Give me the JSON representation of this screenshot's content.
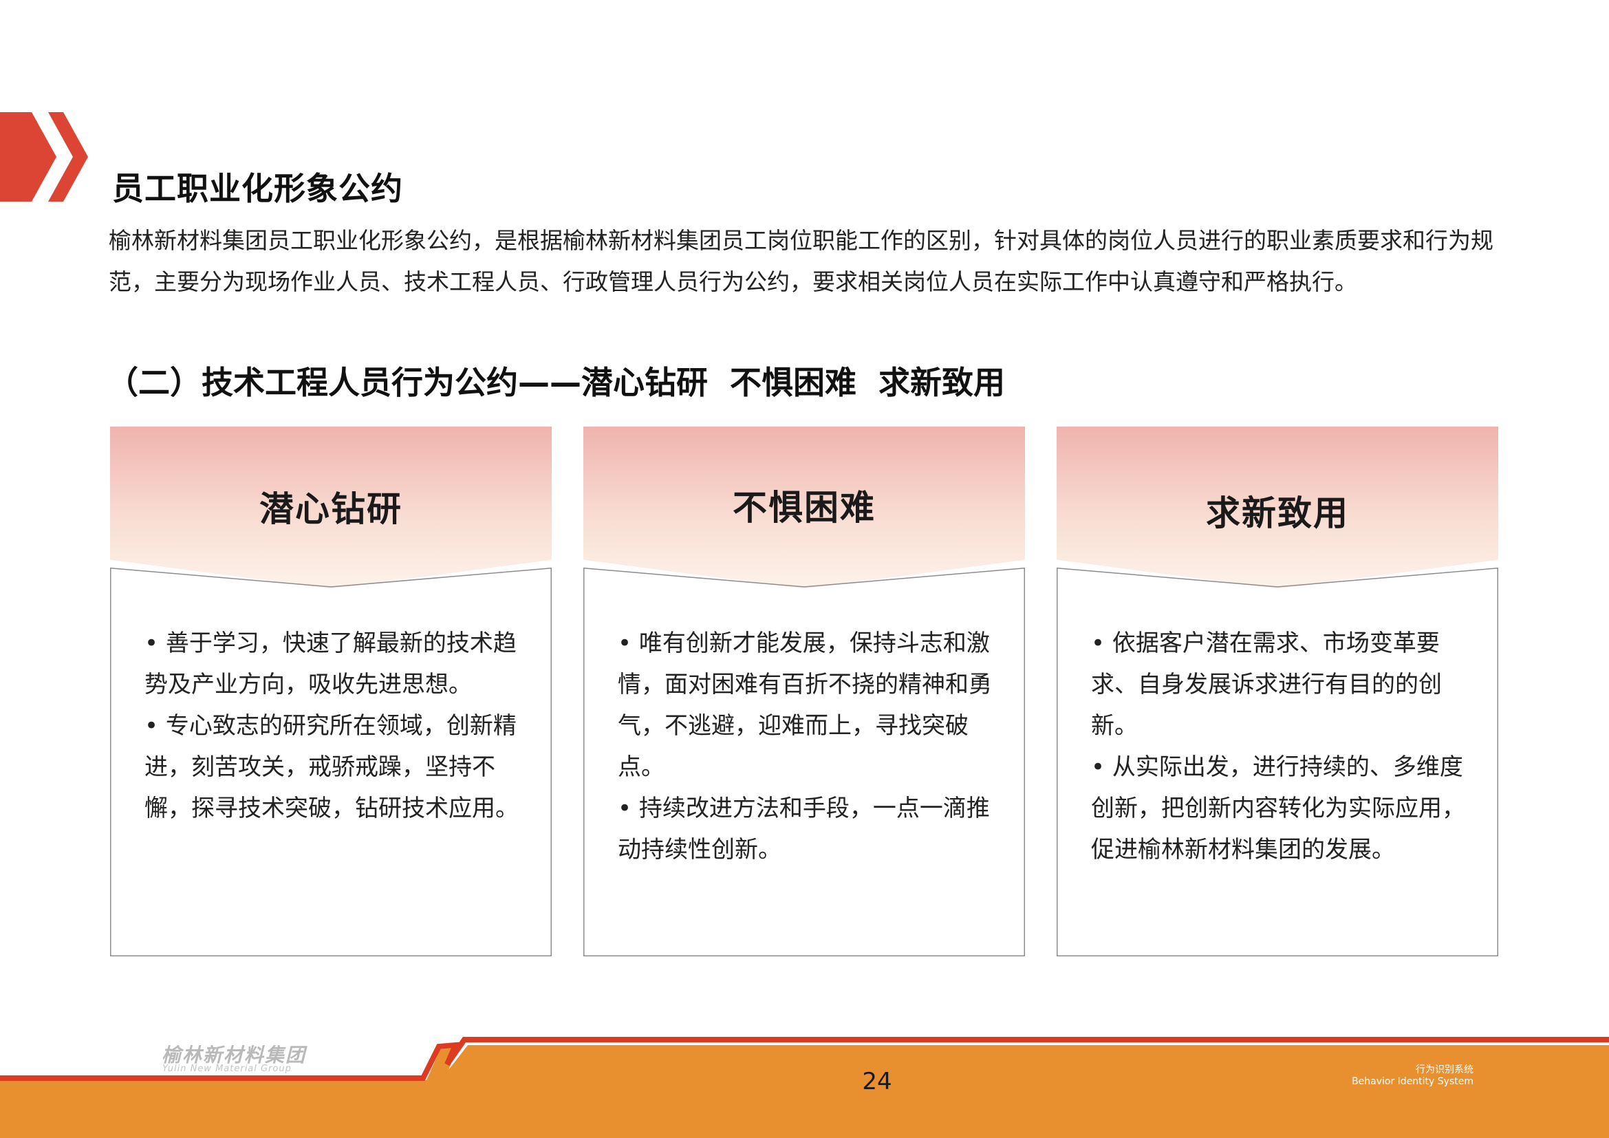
{
  "colors": {
    "accent_red": "#dc4433",
    "footer_orange": "#e8902f",
    "footer_red": "#dc3b1f",
    "card_header_top": "#efb3ad",
    "card_header_bottom": "#fdf3ea"
  },
  "section": {
    "title": "员工职业化形象公约",
    "intro": "榆林新材料集团员工职业化形象公约，是根据榆林新材料集团员工岗位职能工作的区别，针对具体的岗位人员进行的职业素质要求和行为规范，主要分为现场作业人员、技术工程人员、行政管理人员行为公约，要求相关岗位人员在实际工作中认真遵守和严格执行。"
  },
  "subsection": {
    "title": "（二）技术工程人员行为公约——潜心钻研  不惧困难  求新致用"
  },
  "cards": [
    {
      "title": "潜心钻研",
      "points": [
        "• 善于学习，快速了解最新的技术趋势及产业方向，吸收先进思想。",
        "• 专心致志的研究所在领域，创新精进，刻苦攻关，戒骄戒躁，坚持不懈，探寻技术突破，钻研技术应用。"
      ]
    },
    {
      "title": "不惧困难",
      "points": [
        "• 唯有创新才能发展，保持斗志和激情，面对困难有百折不挠的精神和勇气，不逃避，迎难而上，寻找突破点。",
        "• 持续改进方法和手段，一点一滴推动持续性创新。"
      ]
    },
    {
      "title": "求新致用",
      "points": [
        "• 依据客户潜在需求、市场变革要求、自身发展诉求进行有目的的创新。",
        "• 从实际出发，进行持续的、多维度创新，把创新内容转化为实际应用，促进榆林新材料集团的发展。"
      ]
    }
  ],
  "footer": {
    "logo_cn": "榆林新材料集团",
    "logo_en": "Yulin New Material Group",
    "page_number": "24",
    "system_cn": "行为识别系统",
    "system_en": "Behavior Identity System"
  }
}
